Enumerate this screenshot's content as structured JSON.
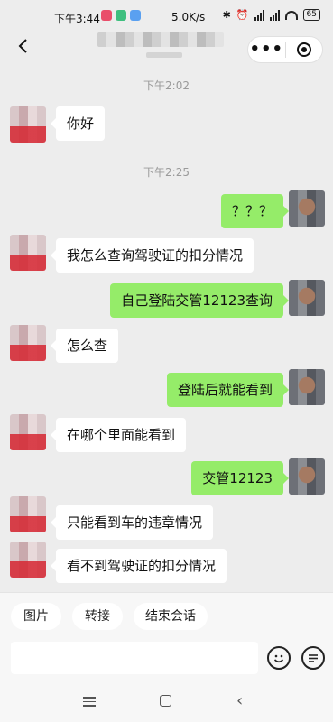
{
  "status_bar": {
    "time": "下午3:44",
    "net_speed": "5.0K/s",
    "battery": "65",
    "app_icon_colors": [
      "#e94e6a",
      "#3fbf7f",
      "#5aa0f0"
    ]
  },
  "header": {
    "back_icon": "chevron-left-icon",
    "more_label": "•••",
    "close_icon": "target-circle-icon"
  },
  "messages": {
    "time1": "下午2:02",
    "m1": "你好",
    "time2": "下午2:25",
    "m2": "？？？",
    "m3": "我怎么查询驾驶证的扣分情况",
    "m4": "自己登陆交管12123查询",
    "m5": "怎么查",
    "m6": "登陆后就能看到",
    "m7": "在哪个里面能看到",
    "m8": "交管12123",
    "m9": "只能看到车的违章情况",
    "m10": "看不到驾驶证的扣分情况"
  },
  "quick_actions": {
    "picture": "图片",
    "transfer": "转接",
    "end_session": "结束会话"
  },
  "input": {
    "value": "",
    "emoji_icon": "emoji-icon",
    "quick_reply_icon": "quick-reply-icon"
  },
  "colors": {
    "bubble_self": "#95ec69",
    "bubble_other": "#ffffff",
    "background": "#ededed"
  }
}
